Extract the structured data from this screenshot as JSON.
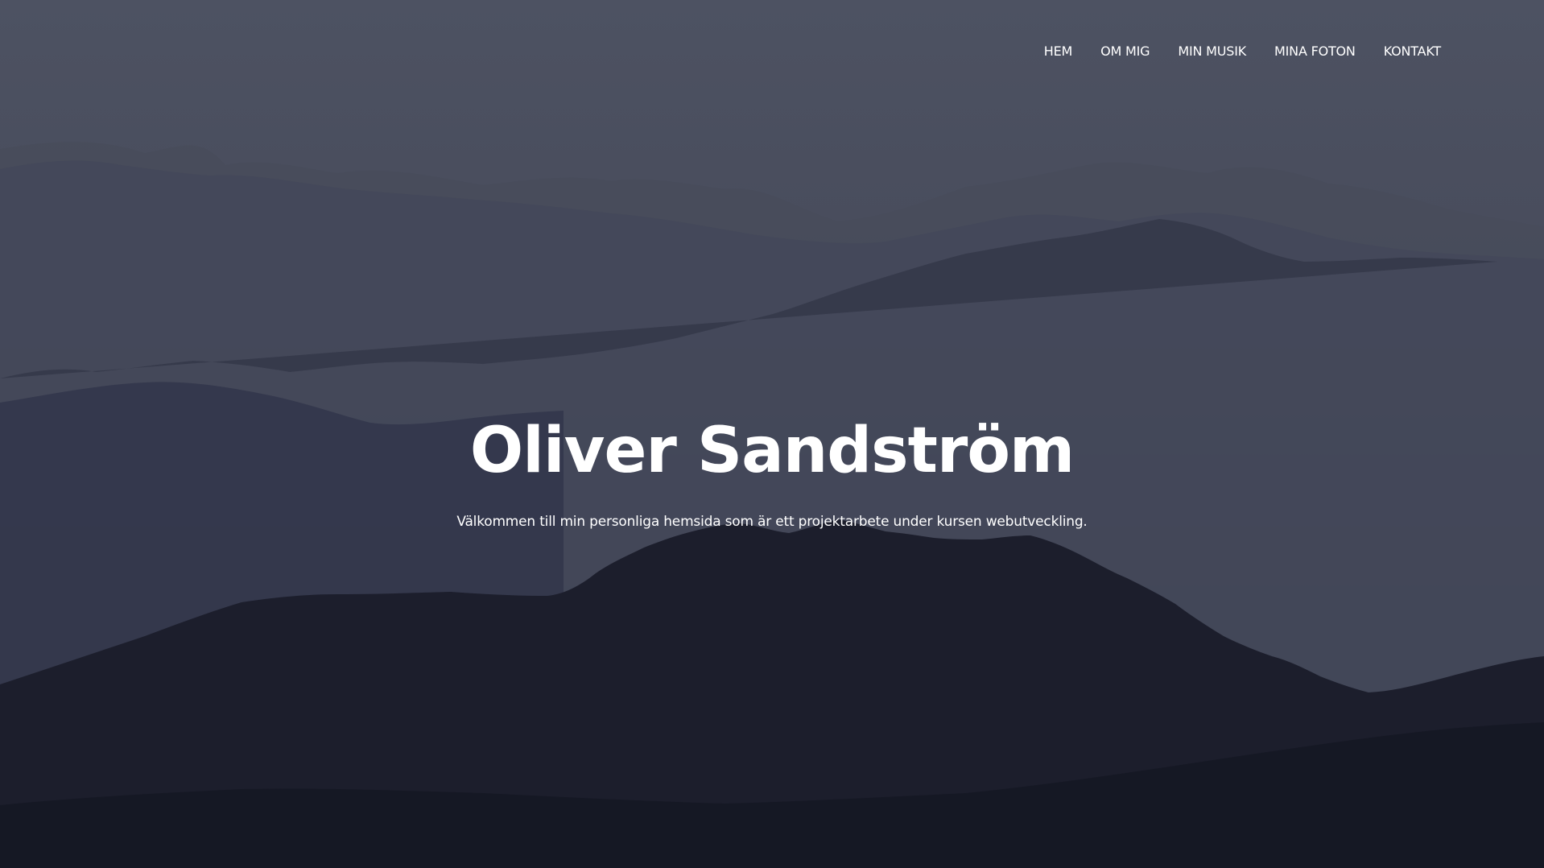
{
  "nav": {
    "items": [
      {
        "label": "HEM"
      },
      {
        "label": "OM MIG"
      },
      {
        "label": "MIN MUSIK"
      },
      {
        "label": "MINA FOTON"
      },
      {
        "label": "KONTAKT"
      }
    ]
  },
  "hero": {
    "title": "Oliver Sandström",
    "subtitle": "Välkommen till min personliga hemsida som är ett projektarbete under kursen webutveckling."
  },
  "colors": {
    "sky": "#4d5262",
    "ridge_far": "#454958",
    "ridge_mid": "#353847",
    "ridge_near": "#1c1e2b",
    "text": "#ffffff"
  }
}
